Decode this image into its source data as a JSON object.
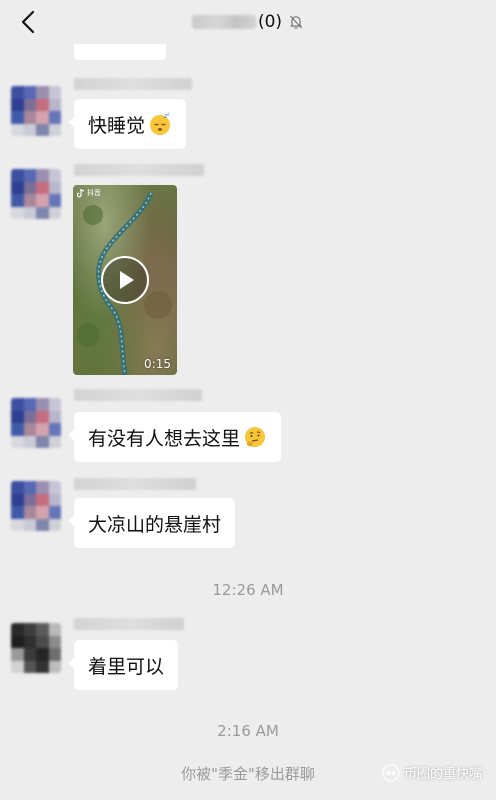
{
  "header": {
    "member_count": "(0)",
    "back_icon": "chevron-left-icon",
    "mute_icon": "bell-off-icon"
  },
  "messages": [
    {
      "text": "快睡觉",
      "emoji": "sleeping-face"
    },
    {
      "type": "video",
      "duration": "0:15",
      "logo": "抖音"
    },
    {
      "text": "有没有人想去这里",
      "emoji": "thinking-face"
    },
    {
      "text": "大凉山的悬崖村"
    },
    {
      "text": "着里可以"
    }
  ],
  "timestamps": [
    "12:26 AM",
    "2:16 AM"
  ],
  "system_message": "你被\"季金\"移出群聊",
  "watermark": {
    "text": "币圈的重快嘴",
    "icon": "wechat-channel-icon"
  },
  "colors": {
    "background": "#ededed",
    "bubble": "#ffffff",
    "meta_text": "#9a9a9a"
  }
}
